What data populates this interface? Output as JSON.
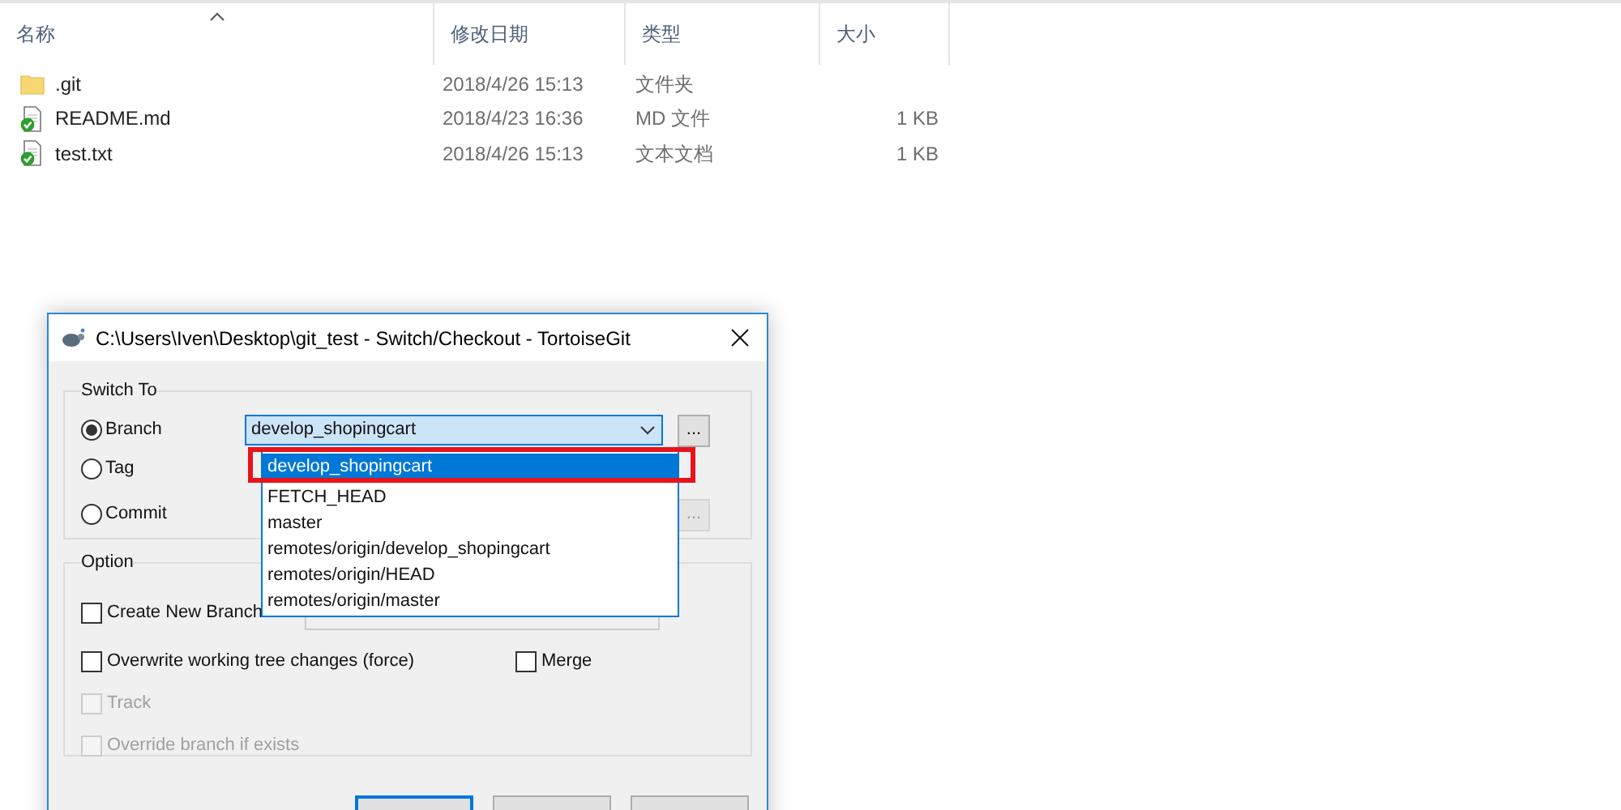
{
  "explorer": {
    "columns": [
      {
        "label": "名称",
        "sorted": true
      },
      {
        "label": "修改日期",
        "sorted": false
      },
      {
        "label": "类型",
        "sorted": false
      },
      {
        "label": "大小",
        "sorted": false
      }
    ],
    "rows": [
      {
        "kind": "folder",
        "name": ".git",
        "modified": "2018/4/26 15:13",
        "type": "文件夹"
      },
      {
        "kind": "file",
        "name": "README.md",
        "modified": "2018/4/23 16:36",
        "type": "MD 文件",
        "size": "1 KB"
      },
      {
        "kind": "file",
        "name": "test.txt",
        "modified": "2018/4/26 15:13",
        "type": "文本文档",
        "size": "1 KB"
      }
    ]
  },
  "dialog": {
    "title": "C:\\Users\\Iven\\Desktop\\git_test - Switch/Checkout - TortoiseGit",
    "switch_to": {
      "label": "Switch To",
      "value": "develop_shopingcart",
      "options": [
        {
          "label": "Branch",
          "selected": true,
          "browse": "...",
          "browse_disabled": false
        },
        {
          "label": "Tag",
          "selected": false
        },
        {
          "label": "Commit",
          "selected": false,
          "browse": "...",
          "browse_disabled": true
        }
      ]
    },
    "dropdown": {
      "items": [
        {
          "label": "develop_shopingcart",
          "selected": true,
          "highlighted": true
        },
        {
          "label": "FETCH_HEAD",
          "selected": false,
          "highlighted": false
        },
        {
          "label": "master",
          "selected": false,
          "highlighted": false
        },
        {
          "label": "remotes/origin/develop_shopingcart",
          "selected": false,
          "highlighted": false
        },
        {
          "label": "remotes/origin/HEAD",
          "selected": false,
          "highlighted": false
        },
        {
          "label": "remotes/origin/master",
          "selected": false,
          "highlighted": false
        }
      ]
    },
    "option": {
      "label": "Option",
      "rows": [
        [
          {
            "kind": "checkbox",
            "label": "Create New Branch",
            "checked": false,
            "disabled": false
          },
          {
            "kind": "field"
          }
        ],
        [
          {
            "kind": "checkbox",
            "label": "Overwrite working tree changes (force)",
            "checked": false,
            "disabled": false
          },
          {
            "kind": "checkbox",
            "label": "Merge",
            "checked": false,
            "disabled": false
          }
        ],
        [
          {
            "kind": "checkbox",
            "label": "Track",
            "checked": false,
            "disabled": true
          }
        ],
        [
          {
            "kind": "checkbox",
            "label": "Override branch if exists",
            "checked": false,
            "disabled": true
          }
        ]
      ]
    },
    "buttons": [
      {
        "default": true
      },
      {
        "default": false
      },
      {
        "default": false
      }
    ]
  }
}
